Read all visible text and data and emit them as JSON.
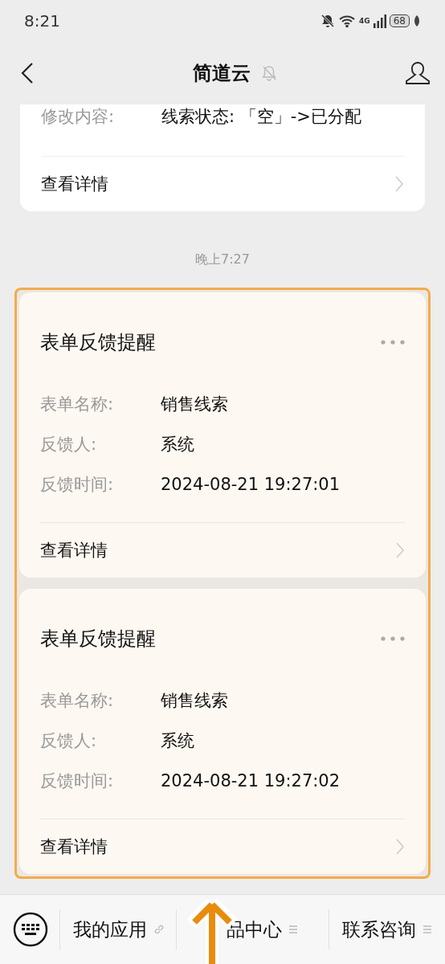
{
  "status_bar": {
    "time": "8:21",
    "network": "4G",
    "battery": "68"
  },
  "header": {
    "title": "简道云",
    "muted": true
  },
  "prev_card": {
    "fields": [
      {
        "label": "修改内容:",
        "value": "线索状态: 「空」->已分配"
      }
    ],
    "link": "查看详情"
  },
  "timestamp": "晚上7:27",
  "highlighted": true,
  "cards": [
    {
      "title": "表单反馈提醒",
      "fields": [
        {
          "label": "表单名称:",
          "value": "销售线索"
        },
        {
          "label": "反馈人:",
          "value": "系统"
        },
        {
          "label": "反馈时间:",
          "value": "2024-08-21 19:27:01"
        }
      ],
      "link": "查看详情"
    },
    {
      "title": "表单反馈提醒",
      "fields": [
        {
          "label": "表单名称:",
          "value": "销售线索"
        },
        {
          "label": "反馈人:",
          "value": "系统"
        },
        {
          "label": "反馈时间:",
          "value": "2024-08-21 19:27:02"
        }
      ],
      "link": "查看详情"
    }
  ],
  "menu": [
    {
      "label": "我的应用",
      "kind": "link"
    },
    {
      "label": "品中心",
      "kind": "submenu"
    },
    {
      "label": "联系咨询",
      "kind": "submenu"
    }
  ]
}
